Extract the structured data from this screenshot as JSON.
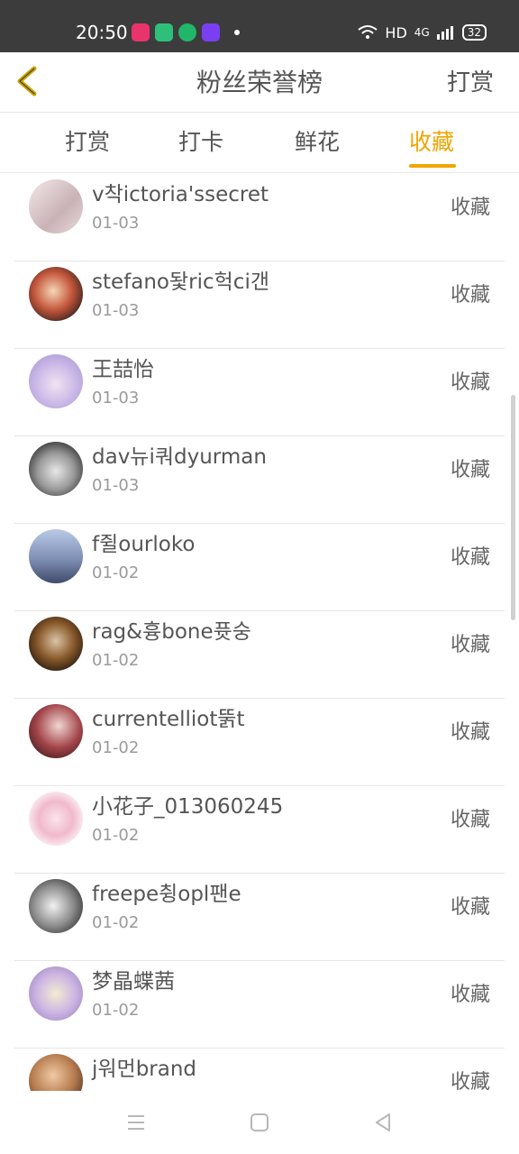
{
  "status_bar": {
    "time": "20:50",
    "network": "HD",
    "signal": "4G",
    "battery": "32",
    "app_icons": [
      {
        "name": "video-app-icon",
        "color": "#e8336d"
      },
      {
        "name": "green-app-icon",
        "color": "#2ec07a"
      },
      {
        "name": "circle-app-icon",
        "color": "#21b76b"
      },
      {
        "name": "video-app-icon-2",
        "color": "#7b3ff2"
      }
    ]
  },
  "header": {
    "back_icon": "chevron-left-icon",
    "title": "粉丝荣誉榜",
    "action_label": "打赏",
    "accent_color": "#f0a500"
  },
  "tabs": [
    {
      "label": "打赏",
      "active": false
    },
    {
      "label": "打卡",
      "active": false
    },
    {
      "label": "鲜花",
      "active": false
    },
    {
      "label": "收藏",
      "active": true
    }
  ],
  "list": [
    {
      "name": "v착ictoria'ssecret",
      "date": "01-03",
      "action": "收藏"
    },
    {
      "name": "stefano돷ric헉ci갠",
      "date": "01-03",
      "action": "收藏"
    },
    {
      "name": "王喆怡",
      "date": "01-03",
      "action": "收藏"
    },
    {
      "name": "dav뉴i쿼dyurman",
      "date": "01-03",
      "action": "收藏"
    },
    {
      "name": "f쥘ourloko",
      "date": "01-02",
      "action": "收藏"
    },
    {
      "name": "rag&흉bone퓻숭",
      "date": "01-02",
      "action": "收藏"
    },
    {
      "name": "currentelliot뚥t",
      "date": "01-02",
      "action": "收藏"
    },
    {
      "name": "小花子_013060245",
      "date": "01-02",
      "action": "收藏"
    },
    {
      "name": "freepe췽opl팬e",
      "date": "01-02",
      "action": "收藏"
    },
    {
      "name": "梦晶蝶茜",
      "date": "01-02",
      "action": "收藏"
    },
    {
      "name": "j워먼brand",
      "date": "",
      "action": "收藏"
    }
  ],
  "navigation": {
    "menu_icon": "menu-icon",
    "home_icon": "home-square-icon",
    "back_icon": "back-triangle-icon"
  }
}
